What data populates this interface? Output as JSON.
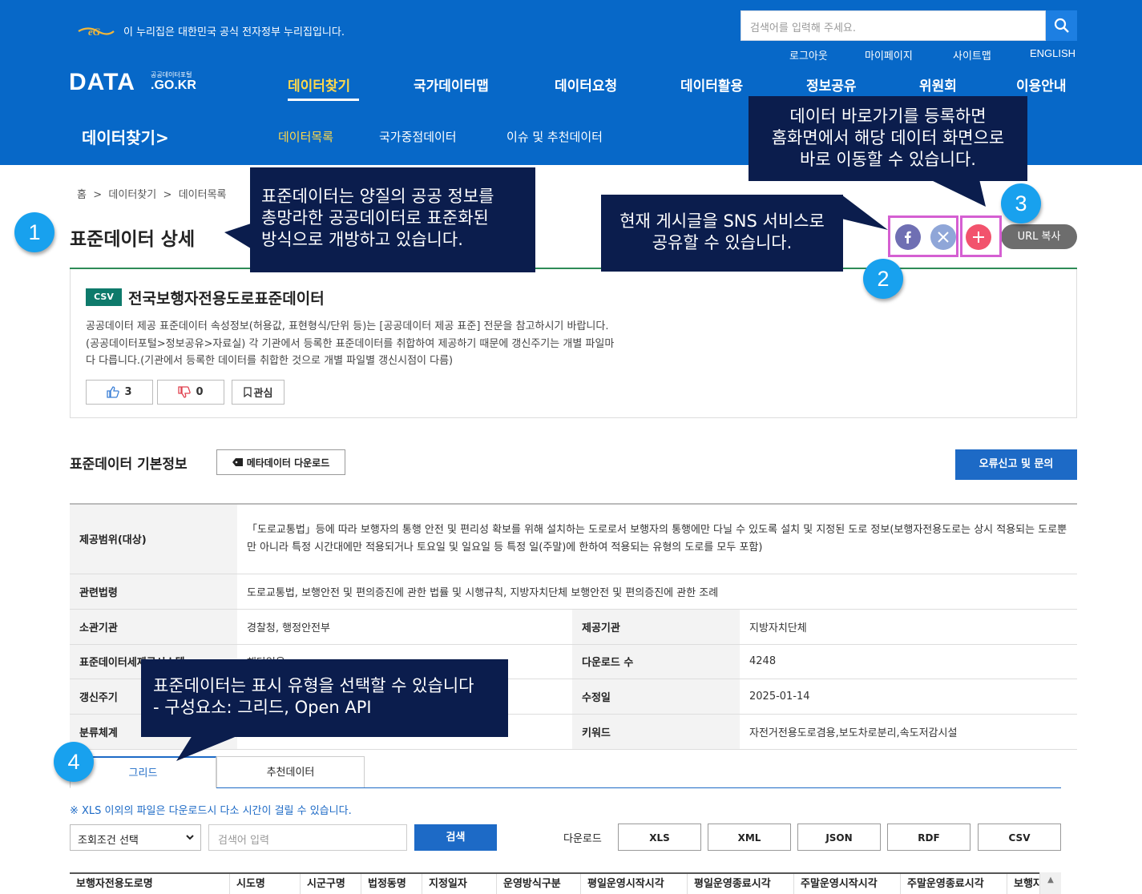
{
  "header": {
    "gov_notice": "이 누리집은 대한민국 공식 전자정부 누리집입니다.",
    "search_placeholder": "검색어를 입력해 주세요.",
    "util_links": [
      "로그아웃",
      "마이페이지",
      "사이트맵",
      "ENGLISH"
    ],
    "logo": {
      "main": "DATA",
      "small_top": "공공데이터포털",
      "small_bottom": ".GO.KR"
    },
    "gnb": [
      "데이터찾기",
      "국가데이터맵",
      "데이터요청",
      "데이터활용",
      "정보공유",
      "위원회",
      "이용안내"
    ],
    "gnb_active": "데이터찾기",
    "section_title": "데이터찾기",
    "lnb": [
      "데이터목록",
      "국가중점데이터",
      "이슈 및 추천데이터"
    ],
    "colors": {
      "header_bg": "#0768c8",
      "active_menu": "#ffd84a"
    }
  },
  "breadcrumb": [
    "홈",
    "데이터찾기",
    "데이터목록"
  ],
  "page_title": "표준데이터 상세",
  "share": {
    "icons": [
      "facebook-icon",
      "x-twitter-icon",
      "plus-icon"
    ],
    "url_copy_label": "URL 복사"
  },
  "data_card": {
    "format_badge": "CSV",
    "title": "전국보행자전용도로표준데이터",
    "description": "공공데이터 제공 표준데이터 속성정보(허용값, 표현형식/단위 등)는 [공공데이터 제공 표준] 전문을 참고하시기 바랍니다.\n(공공데이터포털>정보공유>자료실) 각 기관에서 등록한 표준데이터를 취합하여 제공하기 때문에 갱신주기는 개별 파일마\n다 다릅니다.(기관에서 등록한 데이터를 취합한 것으로 개별 파일별 갱신시점이 다름)",
    "likes": "3",
    "dislikes": "0",
    "interest_label": "관심"
  },
  "basic_info": {
    "title": "표준데이터 기본정보",
    "meta_download_label": "메타데이터 다운로드",
    "report_label": "오류신고 및 문의",
    "rows": {
      "scope_label": "제공범위(대상)",
      "scope_value": "「도로교통법」등에 따라 보행자의 통행 안전 및 편리성 확보를 위해 설치하는 도로로서 보행자의 통행에만 다닐 수 있도록 설치 및 지정된 도로 정보(보행자전용도로는 상시 적용되는 도로뿐만 아니라 특정 시간대에만 적용되거나 토요일 및 일요일 등 특정 일(주말)에 한하여 적용되는 유형의 도로를 모두 포함)",
      "law_label": "관련법령",
      "law_value": "도로교통법, 보행안전 및 편의증진에 관한 법률 및 시행규칙, 지방자치단체 보행안전 및 편의증진에 관한 조례",
      "agency_label": "소관기관",
      "agency_value": "경찰청, 행정안전부",
      "provider_label": "제공기관",
      "provider_value": "지방자치단체",
      "system_label": "표준데이터세제공시스템",
      "system_value": "해당없음",
      "downloads_label": "다운로드 수",
      "downloads_value": "4248",
      "cycle_label": "갱신주기",
      "modified_label": "수정일",
      "modified_value": "2025-01-14",
      "category_label": "분류체계",
      "keyword_label": "키워드",
      "keyword_value": "자전거전용도로겸용,보도차로분리,속도저감시설"
    }
  },
  "tabs": [
    "그리드",
    "추천데이터"
  ],
  "grid": {
    "notice": "※ XLS 이외의 파일은 다운로드시 다소 시간이 걸릴 수 있습니다.",
    "condition_select": "조회조건 선택",
    "keyword_placeholder": "검색어 입력",
    "search_label": "검색",
    "download_label": "다운로드",
    "download_formats": [
      "XLS",
      "XML",
      "JSON",
      "RDF",
      "CSV"
    ],
    "columns": [
      "보행자전용도로명",
      "시도명",
      "시군구명",
      "법정동명",
      "지정일자",
      "운영방식구분",
      "평일운영시작시각",
      "평일운영종료시각",
      "주말운영시작시각",
      "주말운영종료시각",
      "보행자"
    ]
  },
  "callouts": {
    "c1": "표준데이터는 양질의 공공 정보를\n총망라한 공공데이터로 표준화된\n방식으로 개방하고 있습니다.",
    "c2": "현재 게시글을 SNS 서비스로\n공유할 수 있습니다.",
    "c3": "데이터 바로가기를 등록하면\n홈화면에서 해당 데이터 화면으로\n바로 이동할 수 있습니다.",
    "c4": "표준데이터는 표시 유형을 선택할 수 있습니다\n- 구성요소: 그리드, Open API",
    "badges": [
      "1",
      "2",
      "3",
      "4"
    ]
  }
}
